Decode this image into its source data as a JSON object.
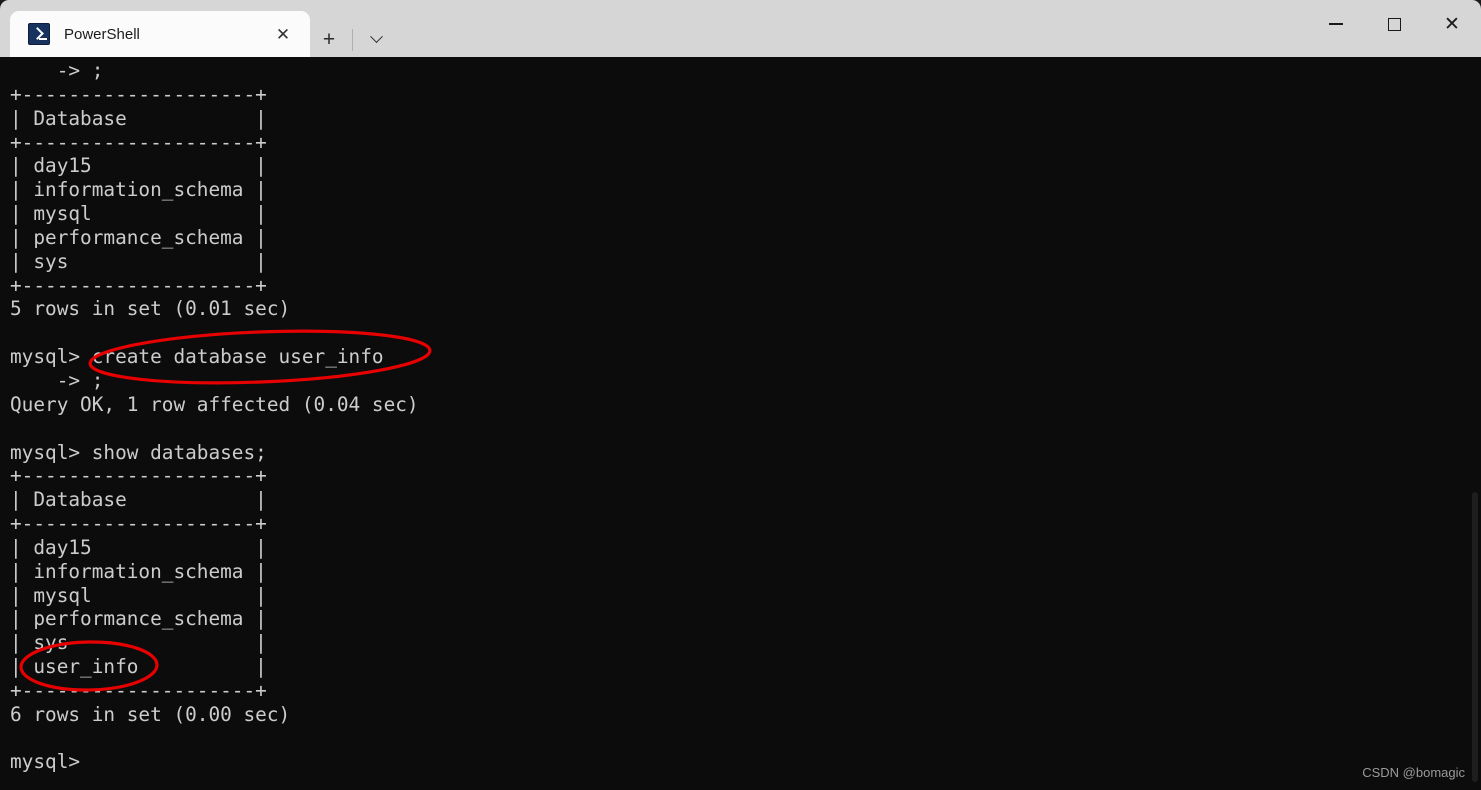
{
  "window": {
    "app_title": "PowerShell",
    "tab_label": "PowerShell",
    "icon": "powershell-icon",
    "close_tab_glyph": "✕",
    "new_tab_glyph": "+",
    "dropdown_glyph": "chevron-down-icon",
    "minimize_glyph": "minimize-icon",
    "maximize_glyph": "maximize-icon",
    "close_glyph": "✕"
  },
  "terminal": {
    "background": "#0c0c0c",
    "foreground": "#cccccc",
    "content": "    -> ;\n+--------------------+\n| Database           |\n+--------------------+\n| day15              |\n| information_schema |\n| mysql              |\n| performance_schema |\n| sys                |\n+--------------------+\n5 rows in set (0.01 sec)\n\nmysql> create database user_info\n    -> ;\nQuery OK, 1 row affected (0.04 sec)\n\nmysql> show databases;\n+--------------------+\n| Database           |\n+--------------------+\n| day15              |\n| information_schema |\n| mysql              |\n| performance_schema |\n| sys                |\n| user_info          |\n+--------------------+\n6 rows in set (0.00 sec)\n\nmysql>",
    "lines": [
      "    -> ;",
      "+--------------------+",
      "| Database           |",
      "+--------------------+",
      "| day15              |",
      "| information_schema |",
      "| mysql              |",
      "| performance_schema |",
      "| sys                |",
      "+--------------------+",
      "5 rows in set (0.01 sec)",
      "",
      "mysql> create database user_info",
      "    -> ;",
      "Query OK, 1 row affected (0.04 sec)",
      "",
      "mysql> show databases;",
      "+--------------------+",
      "| Database           |",
      "+--------------------+",
      "| day15              |",
      "| information_schema |",
      "| mysql              |",
      "| performance_schema |",
      "| sys                |",
      "| user_info          |",
      "+--------------------+",
      "6 rows in set (0.00 sec)",
      "",
      "mysql>"
    ],
    "prompt": "mysql>",
    "databases_before": [
      "day15",
      "information_schema",
      "mysql",
      "performance_schema",
      "sys"
    ],
    "databases_after": [
      "day15",
      "information_schema",
      "mysql",
      "performance_schema",
      "sys",
      "user_info"
    ],
    "result_before": "5 rows in set (0.01 sec)",
    "result_after": "6 rows in set (0.00 sec)",
    "query_ok": "Query OK, 1 row affected (0.04 sec)",
    "command_create": "create database user_info",
    "command_show": "show databases;",
    "column_header": "Database"
  },
  "annotations": {
    "color": "#e60000",
    "ellipse_1_target": "create database user_info",
    "ellipse_2_target": "user_info"
  },
  "watermark": {
    "text": "CSDN @bomagic"
  }
}
